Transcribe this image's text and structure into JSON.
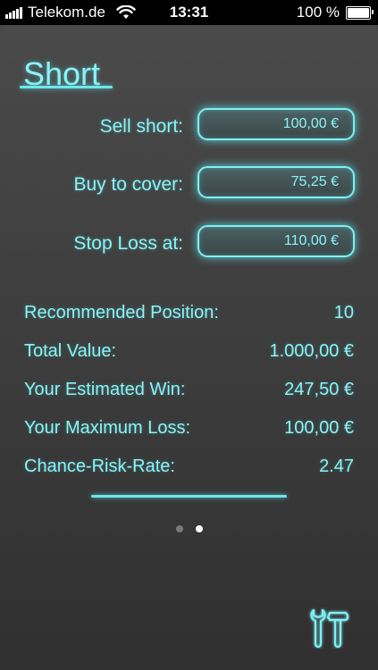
{
  "status_bar": {
    "carrier": "Telekom.de",
    "time": "13:31",
    "battery": "100 %"
  },
  "page": {
    "title": "Short"
  },
  "form": {
    "sell_short": {
      "label": "Sell short:",
      "value": "100,00 €"
    },
    "buy_to_cover": {
      "label": "Buy to cover:",
      "value": "75,25 €"
    },
    "stop_loss": {
      "label": "Stop Loss at:",
      "value": "110,00 €"
    }
  },
  "results": [
    {
      "label": "Recommended Position:",
      "value": "10"
    },
    {
      "label": "Total Value:",
      "value": "1.000,00 €"
    },
    {
      "label": "Your Estimated Win:",
      "value": "247,50 €"
    },
    {
      "label": "Your Maximum Loss:",
      "value": "100,00 €"
    },
    {
      "label": "Chance-Risk-Rate:",
      "value": "2.47"
    }
  ],
  "pagination": {
    "count": 2,
    "active": 2
  },
  "colors": {
    "accent": "#8af4f7",
    "glow": "#5ae6f0",
    "background": "#3e3e3e"
  },
  "icons": {
    "settings": "tools-icon",
    "wifi": "wifi-icon",
    "signal": "signal-icon",
    "battery": "battery-icon"
  }
}
